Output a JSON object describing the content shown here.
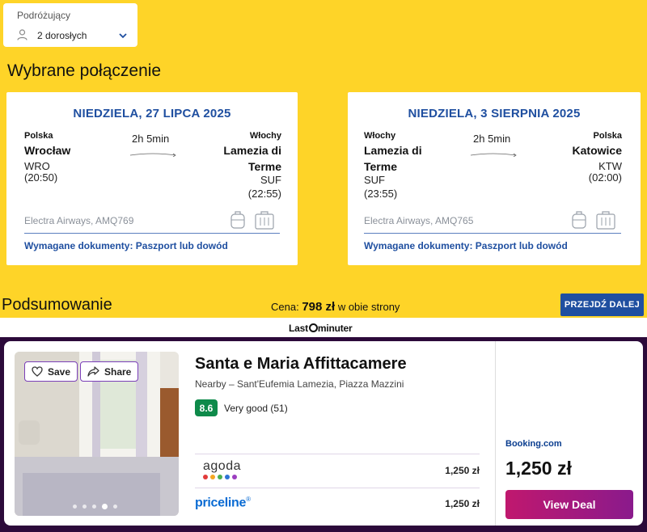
{
  "search": {
    "travellers_label": "Podróżujący",
    "travellers_value": "2 dorosłych"
  },
  "selected_heading": "Wybrane połączenie",
  "flights": [
    {
      "date": "NIEDZIELA, 27 LIPCA 2025",
      "from_country": "Polska",
      "from_city_line1": "Wrocław",
      "from_code": "WRO",
      "from_time": "(20:50)",
      "duration": "2h 5min",
      "to_country": "Włochy",
      "to_city_line1": "Lamezia di",
      "to_city_line2": "Terme",
      "to_code": "SUF",
      "to_time": "(22:55)",
      "airline": "Electra Airways, AMQ769",
      "documents": "Wymagane dokumenty: Paszport lub dowód"
    },
    {
      "date": "NIEDZIELA, 3 SIERPNIA 2025",
      "from_country": "Włochy",
      "from_city_line1": "Lamezia di",
      "from_city_line2": "Terme",
      "from_code": "SUF",
      "from_time": "(23:55)",
      "duration": "2h 5min",
      "to_country": "Polska",
      "to_city_line1": "Katowice",
      "to_code": "KTW",
      "to_time": "(02:00)",
      "airline": "Electra Airways, AMQ765",
      "documents": "Wymagane dokumenty: Paszport lub dowód"
    }
  ],
  "summary": {
    "title": "Podsumowanie",
    "price_prefix": "Cena:",
    "price_value": "798 zł",
    "price_suffix": "w obie strony",
    "next_button": "PRZEJDŹ DALEJ"
  },
  "lastminute": {
    "logo_left": "Last",
    "logo_right": "minuter"
  },
  "hotel": {
    "save_label": "Save",
    "share_label": "Share",
    "name": "Santa e Maria Affittacamere",
    "location": "Nearby – Sant'Eufemia Lamezia, Piazza Mazzini",
    "score": "8.6",
    "rating_text": "Very good (51)",
    "offers": [
      {
        "provider": "agoda",
        "price": "1,250 zł"
      },
      {
        "provider": "priceline",
        "provider_mark": "®",
        "price": "1,250 zł"
      }
    ],
    "featured_provider": "Booking.com",
    "featured_price": "1,250 zł",
    "deal_button": "View Deal",
    "photo_dots": 5,
    "photo_active_dot": 4
  },
  "colors": {
    "brand_yellow": "#fed428",
    "brand_blue": "#1f4fa0",
    "deal_start": "#c0186e",
    "deal_end": "#8a1a8c",
    "score_green": "#0e8a4a",
    "agoda_dots": [
      "#e23b3b",
      "#f4a623",
      "#4caf50",
      "#2e74d6",
      "#9c3fc0"
    ]
  }
}
